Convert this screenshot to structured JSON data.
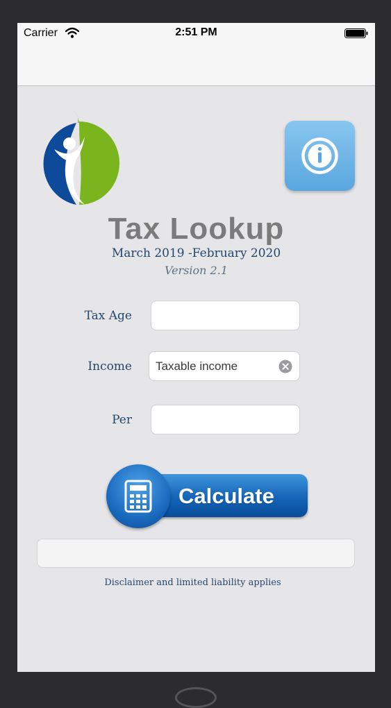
{
  "statusbar": {
    "carrier": "Carrier",
    "time": "2:51 PM"
  },
  "app": {
    "title": "Tax Lookup",
    "period": "March 2019 -February 2020",
    "version": "Version 2.1"
  },
  "form": {
    "tax_age": {
      "label": "Tax Age",
      "value": "",
      "placeholder": ""
    },
    "income": {
      "label": "Income",
      "value": "",
      "placeholder": "Taxable income"
    },
    "per": {
      "label": "Per",
      "value": "",
      "placeholder": ""
    }
  },
  "calculate_label": "Calculate",
  "result_text": "",
  "disclaimer": "Disclaimer and limited liability applies",
  "icons": {
    "wifi": "wifi-icon",
    "battery": "battery-icon",
    "logo": "person-logo",
    "info": "info-icon",
    "clear": "clear-icon",
    "calculator": "calculator-icon"
  },
  "colors": {
    "accent_blue": "#1464b8",
    "label_navy": "#23466f",
    "logo_green": "#7ab51d",
    "logo_blue": "#0d4a9a",
    "title_gray": "#7b7b7b"
  }
}
